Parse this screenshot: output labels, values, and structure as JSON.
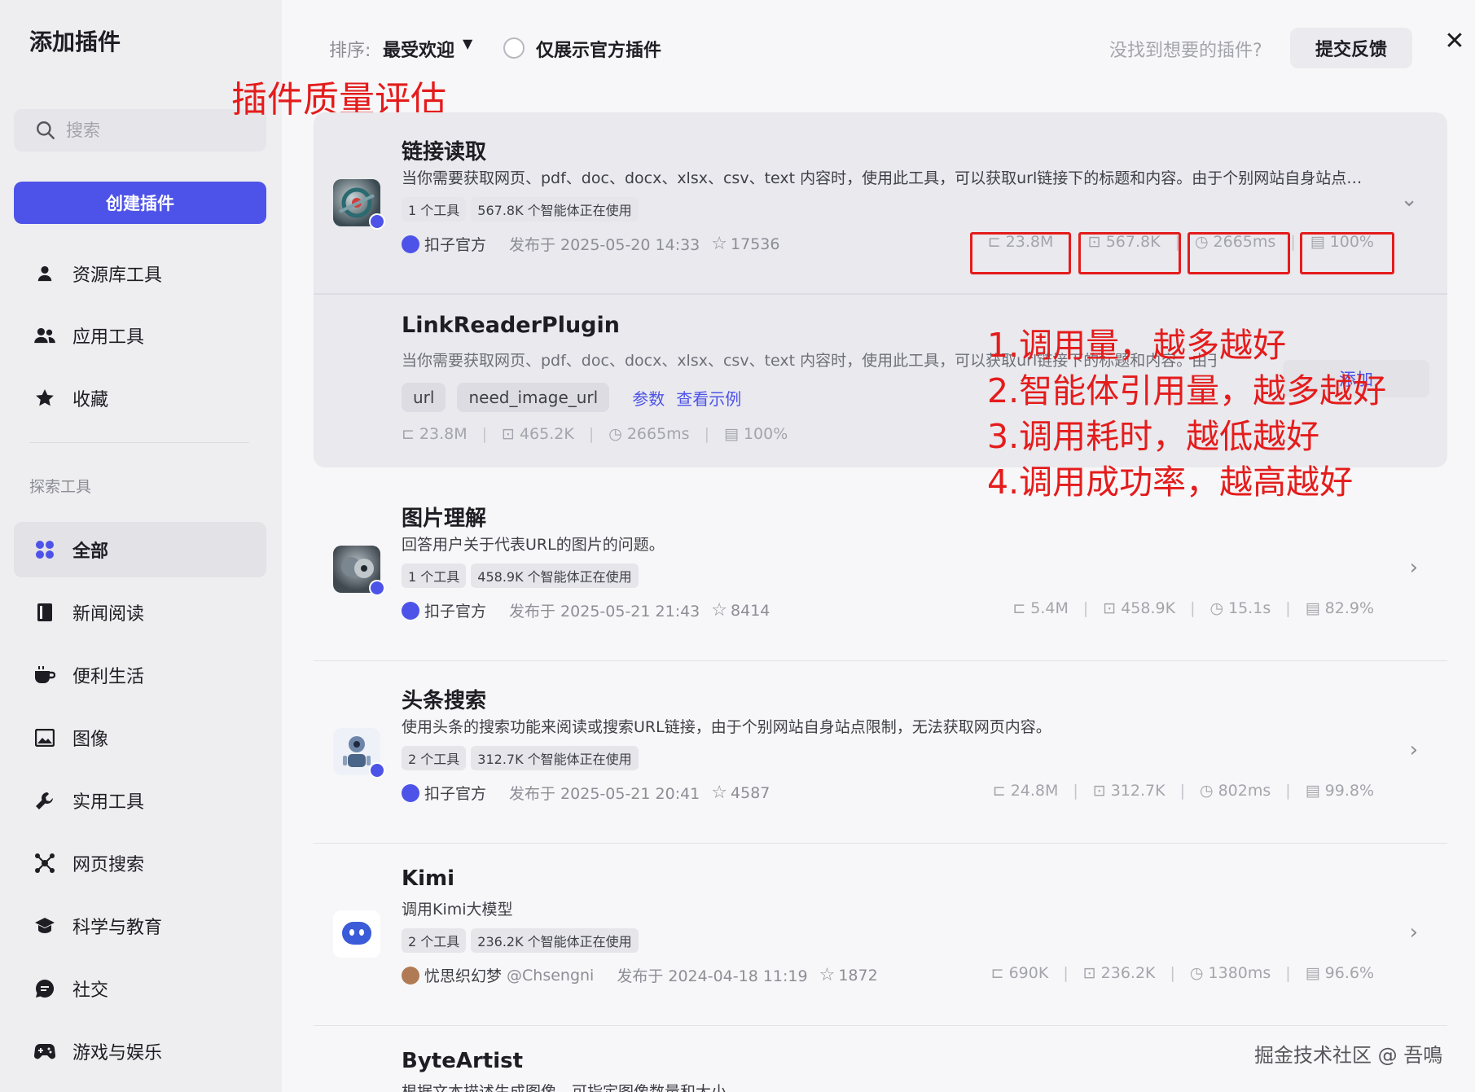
{
  "sidebar": {
    "title": "添加插件",
    "search_placeholder": "搜索",
    "create_label": "创建插件",
    "items": [
      {
        "label": "资源库工具",
        "icon": "user-icon"
      },
      {
        "label": "应用工具",
        "icon": "users-icon"
      },
      {
        "label": "收藏",
        "icon": "star-icon"
      }
    ],
    "section_label": "探索工具",
    "categories": [
      {
        "label": "全部",
        "icon": "grid-icon",
        "active": true
      },
      {
        "label": "新闻阅读",
        "icon": "book-icon"
      },
      {
        "label": "便利生活",
        "icon": "coffee-icon"
      },
      {
        "label": "图像",
        "icon": "image-icon"
      },
      {
        "label": "实用工具",
        "icon": "wrench-icon"
      },
      {
        "label": "网页搜索",
        "icon": "network-icon"
      },
      {
        "label": "科学与教育",
        "icon": "graduation-cap-icon"
      },
      {
        "label": "社交",
        "icon": "chat-icon"
      },
      {
        "label": "游戏与娱乐",
        "icon": "gamepad-icon"
      }
    ]
  },
  "topbar": {
    "sort_label": "排序:",
    "sort_value": "最受欢迎",
    "official_only_label": "仅展示官方插件",
    "not_found_text": "没找到想要的插件?",
    "feedback_label": "提交反馈",
    "close_label": "✕"
  },
  "annotations": {
    "title": "插件质量评估",
    "list": [
      "1.调用量，越多越好",
      "2.智能体引用量，越多越好",
      "3.调用耗时，越低越好",
      "4.调用成功率，越高越好"
    ]
  },
  "plugins": [
    {
      "name": "链接读取",
      "desc": "当你需要获取网页、pdf、doc、docx、xlsx、csv、text 内容时，使用此工具，可以获取url链接下的标题和内容。由于个别网站自身站点…",
      "tools_tag": "1 个工具",
      "usage_tag": "567.8K 个智能体正在使用",
      "author": "扣子官方",
      "published": "发布于 2025-05-20 14:33",
      "stars": "17536",
      "calls": "23.8M",
      "bots": "567.8K",
      "latency": "2665ms",
      "success": "100%"
    },
    {
      "name": "图片理解",
      "desc": "回答用户关于代表URL的图片的问题。",
      "tools_tag": "1 个工具",
      "usage_tag": "458.9K 个智能体正在使用",
      "author": "扣子官方",
      "published": "发布于 2025-05-21 21:43",
      "stars": "8414",
      "calls": "5.4M",
      "bots": "458.9K",
      "latency": "15.1s",
      "success": "82.9%"
    },
    {
      "name": "头条搜索",
      "desc": "使用头条的搜索功能来阅读或搜索URL链接，由于个别网站自身站点限制，无法获取网页内容。",
      "tools_tag": "2 个工具",
      "usage_tag": "312.7K 个智能体正在使用",
      "author": "扣子官方",
      "published": "发布于 2025-05-21 20:41",
      "stars": "4587",
      "calls": "24.8M",
      "bots": "312.7K",
      "latency": "802ms",
      "success": "99.8%"
    },
    {
      "name": "Kimi",
      "desc": "调用Kimi大模型",
      "tools_tag": "2 个工具",
      "usage_tag": "236.2K 个智能体正在使用",
      "author": "忧思织幻梦",
      "author_handle": "@Chsengni",
      "published": "发布于 2024-04-18 11:19",
      "stars": "1872",
      "calls": "690K",
      "bots": "236.2K",
      "latency": "1380ms",
      "success": "96.6%"
    },
    {
      "name": "ByteArtist",
      "desc": "根据文本描述生成图像，可指定图像数量和大小。"
    }
  ],
  "tool": {
    "name": "LinkReaderPlugin",
    "desc": "当你需要获取网页、pdf、doc、docx、xlsx、csv、text 内容时，使用此工具，可以获取url链接下的标题和内容。由于…",
    "params": [
      "url",
      "need_image_url"
    ],
    "params_link": "参数",
    "example_link": "查看示例",
    "add_label": "添加",
    "calls": "23.8M",
    "bots": "465.2K",
    "latency": "2665ms",
    "success": "100%"
  },
  "watermark": "掘金技术社区 @ 吾鳴",
  "colors": {
    "accent": "#4d53e8",
    "annotation": "#e41c1c"
  }
}
